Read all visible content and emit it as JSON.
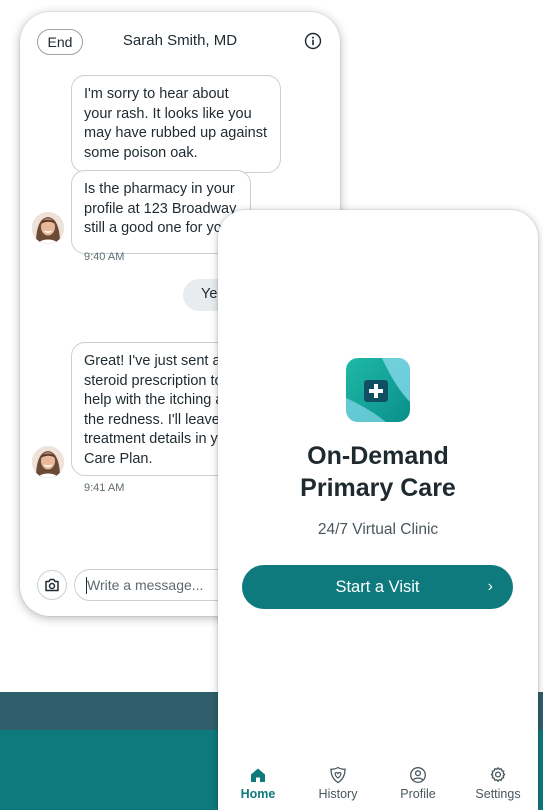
{
  "chat": {
    "end_label": "End",
    "title": "Sarah Smith, MD",
    "icons": {
      "info": "info-icon",
      "camera": "camera-icon"
    },
    "messages": [
      {
        "lines": [
          "I'm sorry to hear about",
          "your rash. It looks like you",
          "may have rubbed up against",
          "some poison oak."
        ]
      },
      {
        "lines": [
          "Is the pharmacy in your",
          "profile at 123 Broadway",
          "still a good one for you?"
        ],
        "time": "9:40 AM"
      },
      {
        "lines": [
          "Great! I've just sent a",
          "steroid prescription to",
          "help with the itching and",
          "the redness. I'll leave",
          "treatment details in your",
          "Care Plan."
        ],
        "time": "9:41 AM"
      }
    ],
    "reply": "Yes",
    "composer_placeholder": "Write a message..."
  },
  "home": {
    "title_line1": "On-Demand",
    "title_line2": "Primary Care",
    "subtitle": "24/7 Virtual Clinic",
    "start_label": "Start a Visit",
    "start_chevron": "›",
    "tabs": [
      {
        "label": "Home",
        "icon": "home-icon",
        "active": true
      },
      {
        "label": "History",
        "icon": "heart-shield-icon",
        "active": false
      },
      {
        "label": "Profile",
        "icon": "user-circle-icon",
        "active": false
      },
      {
        "label": "Settings",
        "icon": "gear-icon",
        "active": false
      }
    ]
  },
  "colors": {
    "accent": "#0f7a7e",
    "band_dark": "#2f5f6b",
    "band_teal": "#0f7a7e"
  }
}
